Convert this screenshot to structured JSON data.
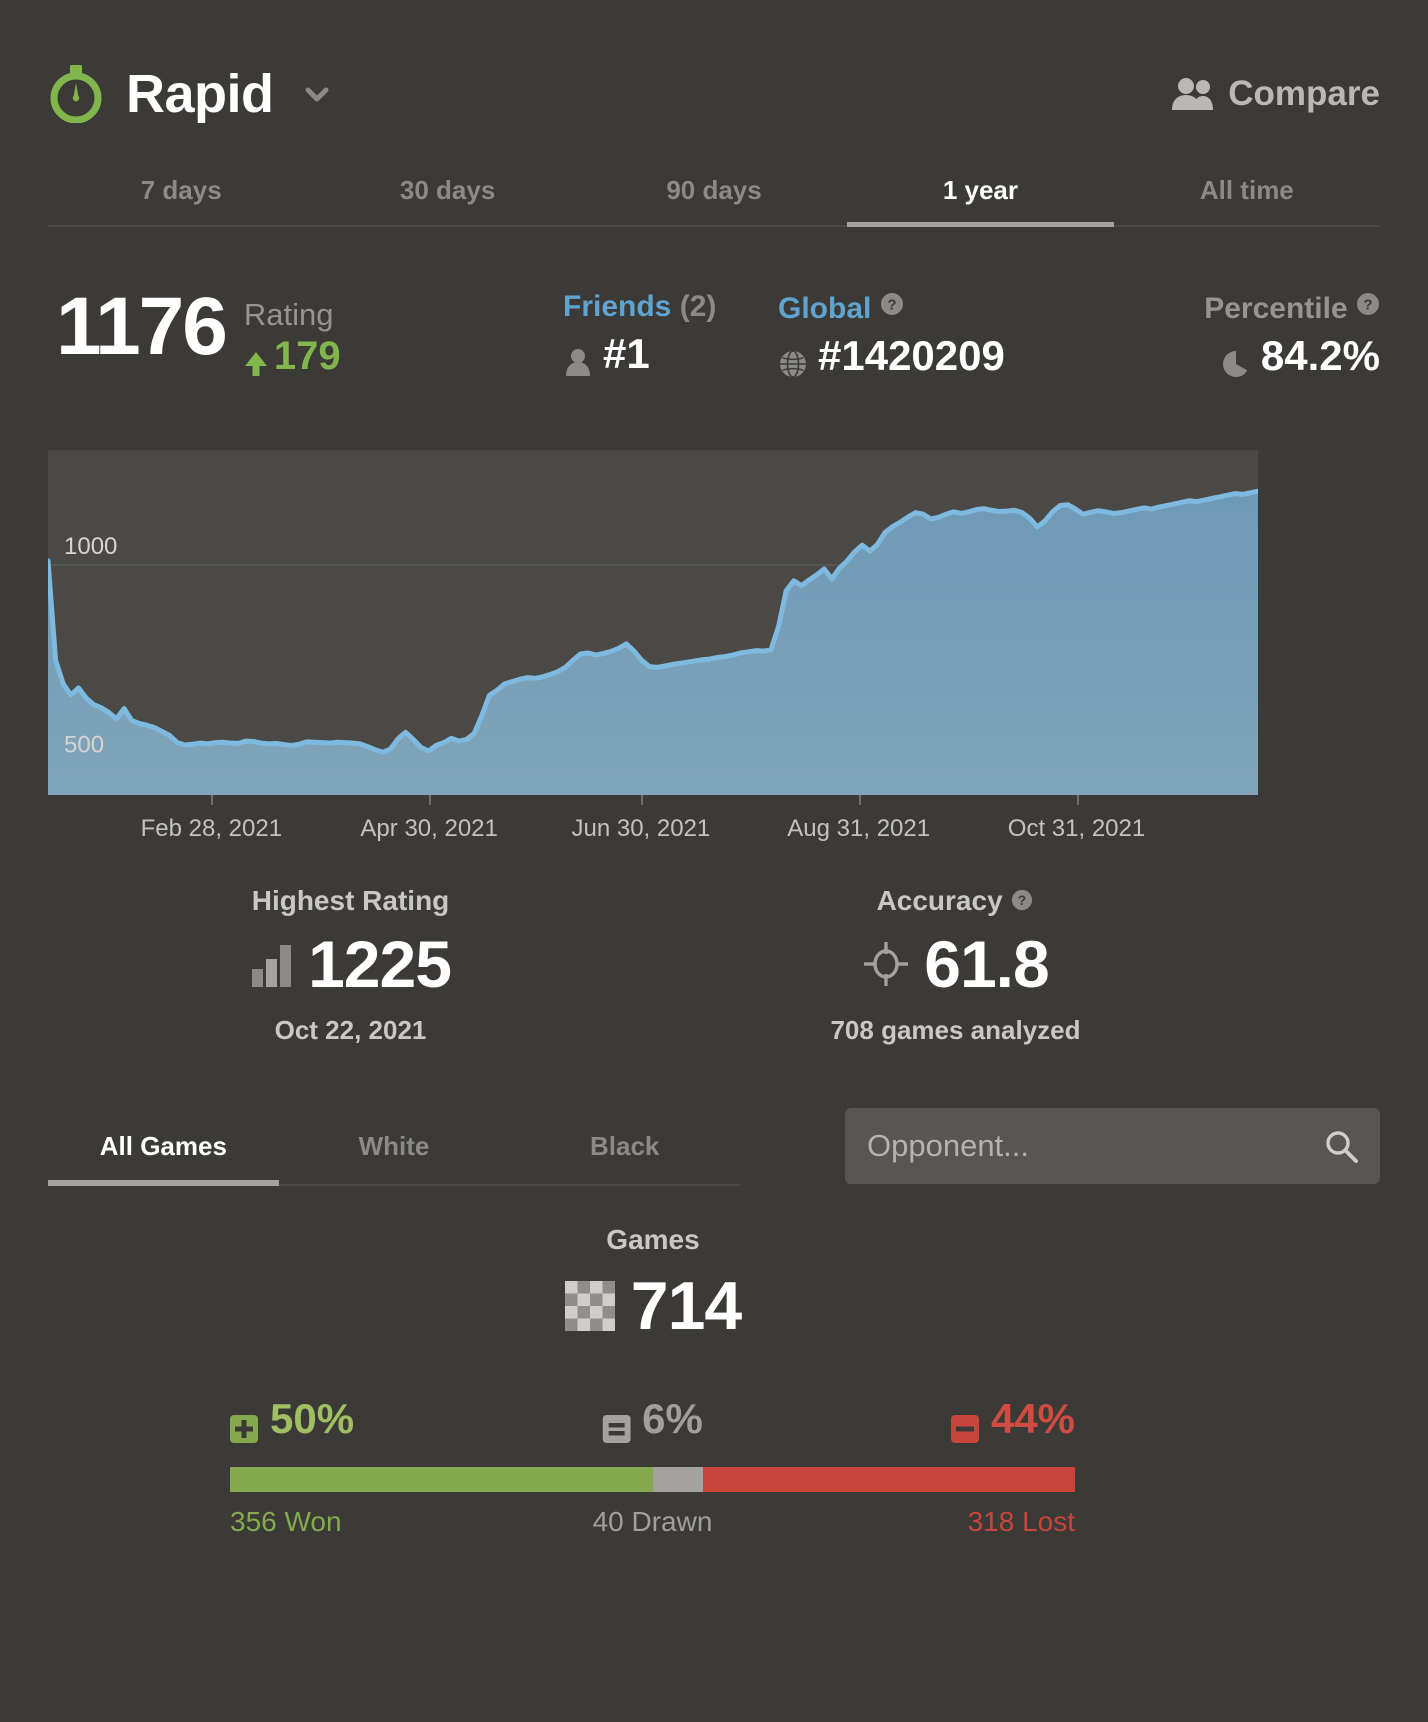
{
  "header": {
    "title": "Rapid",
    "icon": "stopwatch-icon",
    "dropdown_icon": "chevron-down-icon",
    "compare_label": "Compare",
    "compare_icon": "people-icon"
  },
  "time_tabs": {
    "items": [
      {
        "label": "7 days",
        "active": false
      },
      {
        "label": "30 days",
        "active": false
      },
      {
        "label": "90 days",
        "active": false
      },
      {
        "label": "1 year",
        "active": true
      },
      {
        "label": "All time",
        "active": false
      }
    ]
  },
  "stats": {
    "rating_value": "1176",
    "rating_label": "Rating",
    "rating_delta": "179",
    "rating_delta_icon": "arrow-up-icon",
    "rating_delta_color": "#81b64c",
    "friends_label": "Friends",
    "friends_count": "(2)",
    "friends_rank": "#1",
    "friends_icon": "person-icon",
    "global_label": "Global",
    "global_rank": "#1420209",
    "global_icon": "globe-icon",
    "help_icon": "question-mark-icon",
    "percentile_label": "Percentile",
    "percentile_value": "84.2%",
    "percentile_icon": "pie-clock-icon",
    "link_color": "#5fa3d0"
  },
  "chart_data": {
    "type": "area",
    "title": "Rapid rating history",
    "xlabel": "",
    "ylabel": "Rating",
    "ylim": [
      420,
      1290
    ],
    "xlim": [
      "Jan 2021",
      "Dec 2021"
    ],
    "grid": true,
    "line_color": "#7eb9df",
    "fill_top_color": "#6f9bb8",
    "fill_bottom_color": "#7fa3b8",
    "y_ticks": [
      500,
      1000
    ],
    "y_tick_labels": [
      "500",
      "1000"
    ],
    "x_ticks": [
      "Feb 28, 2021",
      "Apr 30, 2021",
      "Jun 30, 2021",
      "Aug 31, 2021",
      "Oct 31, 2021"
    ],
    "x_tick_positions_pct": [
      13.5,
      31.5,
      49.0,
      67.0,
      85.0
    ],
    "series": [
      {
        "name": "Rating",
        "values": [
          1010,
          760,
          700,
          672,
          690,
          665,
          648,
          640,
          628,
          612,
          638,
          608,
          600,
          596,
          590,
          580,
          570,
          552,
          546,
          548,
          551,
          549,
          552,
          553,
          551,
          550,
          556,
          555,
          551,
          549,
          550,
          547,
          545,
          548,
          554,
          553,
          552,
          551,
          553,
          552,
          551,
          549,
          542,
          534,
          528,
          536,
          562,
          578,
          560,
          540,
          531,
          545,
          552,
          563,
          556,
          560,
          575,
          620,
          671,
          684,
          700,
          706,
          712,
          716,
          714,
          718,
          724,
          731,
          742,
          760,
          776,
          778,
          773,
          777,
          782,
          790,
          801,
          783,
          760,
          744,
          742,
          745,
          749,
          752,
          755,
          758,
          761,
          763,
          767,
          769,
          773,
          778,
          781,
          784,
          783,
          786,
          845,
          935,
          960,
          948,
          962,
          975,
          990,
          965,
          992,
          1010,
          1033,
          1050,
          1035,
          1052,
          1082,
          1097,
          1108,
          1121,
          1132,
          1128,
          1116,
          1120,
          1128,
          1134,
          1130,
          1134,
          1140,
          1142,
          1138,
          1135,
          1136,
          1138,
          1132,
          1118,
          1096,
          1111,
          1134,
          1150,
          1152,
          1141,
          1128,
          1133,
          1137,
          1134,
          1130,
          1132,
          1136,
          1140,
          1144,
          1141,
          1146,
          1150,
          1154,
          1158,
          1162,
          1160,
          1164,
          1168,
          1172,
          1176,
          1180,
          1178,
          1182,
          1186
        ]
      }
    ]
  },
  "mid_stats": [
    {
      "caption": "Highest Rating",
      "icon": "bar-chart-icon",
      "value": "1225",
      "sub": "Oct 22, 2021",
      "has_help": false
    },
    {
      "caption": "Accuracy",
      "icon": "target-icon",
      "value": "61.8",
      "sub": "708 games analyzed",
      "has_help": true
    }
  ],
  "color_tabs": {
    "items": [
      {
        "label": "All Games",
        "active": true
      },
      {
        "label": "White",
        "active": false
      },
      {
        "label": "Black",
        "active": false
      }
    ]
  },
  "search": {
    "placeholder": "Opponent...",
    "value": "",
    "icon": "search-icon"
  },
  "games": {
    "caption": "Games",
    "icon": "chessboard-icon",
    "value": "714"
  },
  "wdl": {
    "win_pct": "50%",
    "draw_pct": "6%",
    "loss_pct": "44%",
    "win_count": "356 Won",
    "draw_count": "40 Drawn",
    "loss_count": "318 Lost",
    "win_icon": "plus-badge-icon",
    "draw_icon": "equals-badge-icon",
    "loss_icon": "minus-badge-icon",
    "win_color": "#85a94f",
    "draw_color": "#a3a2a0",
    "loss_color": "#c8453b",
    "bar_win_width_pct": 50,
    "bar_draw_width_pct": 6,
    "bar_loss_width_pct": 44
  }
}
